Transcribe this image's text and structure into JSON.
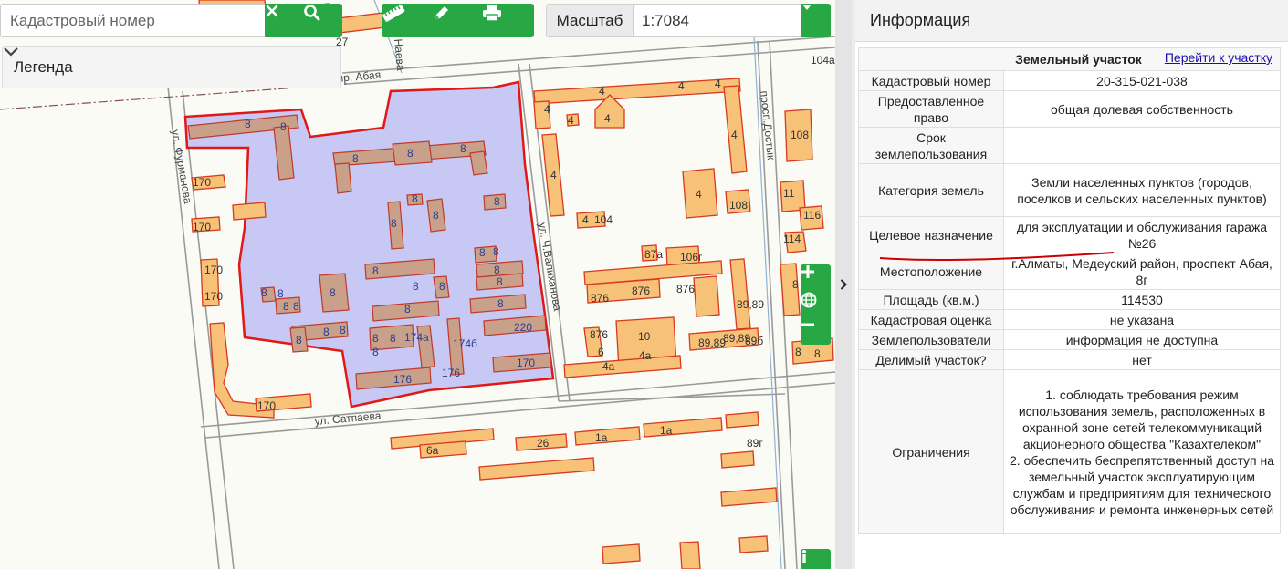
{
  "toolbar": {
    "search_placeholder": "Кадастровый номер",
    "scale_label": "Масштаб",
    "scale_value": "1:7084",
    "legend_label": "Легенда"
  },
  "map": {
    "streets": [
      "пр. Абая",
      "ул. Фурманова",
      "ул. Ч.Валиханова",
      "ул. Сатпаева",
      "просп.Достык",
      "Наева"
    ],
    "labels": [
      "27",
      "104а",
      "4",
      "4",
      "4",
      "4",
      "4",
      "4",
      "4",
      "4",
      "4",
      "4",
      "104",
      "87а",
      "106г",
      "108",
      "108",
      "11",
      "116",
      "114",
      "8",
      "8",
      "8",
      "8",
      "8",
      "8",
      "8",
      "8",
      "8",
      "8",
      "8",
      "8",
      "8",
      "8",
      "8",
      "8",
      "8",
      "8",
      "8",
      "8",
      "8",
      "8",
      "8",
      "8",
      "8",
      "8",
      "8",
      "8",
      "8",
      "8",
      "8",
      "8",
      "174а",
      "174б",
      "176",
      "176",
      "220",
      "170",
      "170",
      "170",
      "170",
      "170",
      "170",
      "876",
      "876",
      "876",
      "876",
      "10",
      "6",
      "4а",
      "4а",
      "89,89",
      "89,89",
      "89б",
      "89,89",
      "6а",
      "26",
      "1а",
      "1а",
      "89г"
    ]
  },
  "panel": {
    "title": "Информация",
    "section_title": "Земельный участок",
    "goto_link": "Перейти к участку",
    "rows": [
      {
        "key": "Кадастровый номер",
        "value": "20-315-021-038"
      },
      {
        "key": "Предоставленное право",
        "value": "общая долевая собственность"
      },
      {
        "key": "Срок землепользования",
        "value": ""
      },
      {
        "key": "Категория земель",
        "value": "Земли населенных пунктов (городов, поселков и сельских населенных пунктов)"
      },
      {
        "key": "Целевое назначение",
        "value": "для эксплуатации и обслуживания гаража №26"
      },
      {
        "key": "Местоположение",
        "value": "г.Алматы, Медеуский район, проспект Абая, 8г"
      },
      {
        "key": "Площадь (кв.м.)",
        "value": "114530"
      },
      {
        "key": "Кадастровая оценка",
        "value": "не указана"
      },
      {
        "key": "Землепользователи",
        "value": "информация не доступна"
      },
      {
        "key": "Делимый участок?",
        "value": "нет"
      },
      {
        "key": "Ограничения",
        "value": "1. соблюдать требования режим использования земель, расположенных в охранной зоне сетей телекоммуникаций акционерного общества \"Казахтелеком\"\n2. обеспечить беспрепятственный доступ на земельный участок эксплуатирующим службам и предприятиям для технического обслуживания и ремонта инженерных сетей"
      }
    ]
  },
  "colors": {
    "accent_green": "#28a745",
    "parcel_fill": "#c8c8f5",
    "parcel_stroke": "#e01818",
    "building_fill": "#f7c178"
  },
  "icons": [
    "close-icon",
    "search-icon",
    "ruler-icon",
    "pencil-icon",
    "print-icon",
    "chevron-down-icon",
    "caret-down-icon",
    "zoom-in-icon",
    "globe-icon",
    "zoom-out-icon",
    "info-icon",
    "chevron-right-icon"
  ]
}
